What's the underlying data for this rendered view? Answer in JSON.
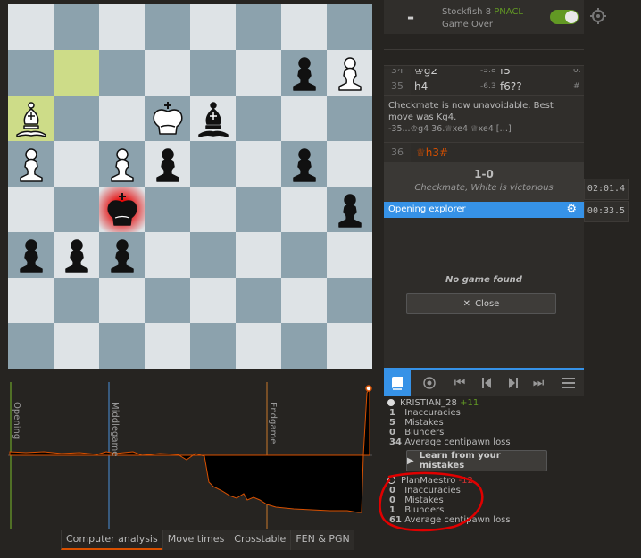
{
  "board": {
    "squares": [
      {
        "sq": "g7",
        "piece": "bp"
      },
      {
        "sq": "h7",
        "piece": "wp"
      },
      {
        "sq": "a6",
        "piece": "wb"
      },
      {
        "sq": "d6",
        "piece": "wk"
      },
      {
        "sq": "e6",
        "piece": "bb"
      },
      {
        "sq": "a5",
        "piece": "wp"
      },
      {
        "sq": "c5",
        "piece": "wp"
      },
      {
        "sq": "d5",
        "piece": "bp"
      },
      {
        "sq": "g5",
        "piece": "bp"
      },
      {
        "sq": "c4",
        "piece": "bk"
      },
      {
        "sq": "h4",
        "piece": "bp"
      },
      {
        "sq": "a3",
        "piece": "bp"
      },
      {
        "sq": "b3",
        "piece": "bp"
      },
      {
        "sq": "c3",
        "piece": "bp"
      }
    ],
    "highlights": [
      "b7",
      "a6"
    ],
    "check": "c4"
  },
  "chart": {
    "phases": [
      "Opening",
      "Middlegame",
      "Endgame"
    ]
  },
  "analysis_tabs": [
    "Computer analysis",
    "Move times",
    "Crosstable",
    "FEN & PGN"
  ],
  "engine": {
    "eval": "-",
    "name": "Stockfish 8",
    "variant": "PNACL",
    "status": "Game Over"
  },
  "moves": {
    "row34": {
      "num": "34",
      "white": "♔g2",
      "wev": "-5.8",
      "black": "f5",
      "bev": "0."
    },
    "row35": {
      "num": "35",
      "white": "h4",
      "wev": "-6.3",
      "black": "f6??",
      "bev": "#"
    },
    "comment": "Checkmate is now unavoidable. Best move was Kg4.",
    "variation": "-35...♔g4 36.♕xe4 ♕xe4 […]",
    "row36": {
      "num": "36",
      "white": "♕h3#"
    }
  },
  "result": {
    "score": "1-0",
    "message": "Checkmate, White is victorious"
  },
  "explorer": {
    "title": "Opening explorer",
    "no_game": "No game found",
    "close": "Close"
  },
  "clocks": {
    "top": "02:01.4",
    "bottom": "00:33.5"
  },
  "summary": {
    "white": {
      "name": "KRISTIAN_28",
      "diff": "+11",
      "stats": [
        {
          "n": "1",
          "label": "Inaccuracies"
        },
        {
          "n": "5",
          "label": "Mistakes"
        },
        {
          "n": "0",
          "label": "Blunders"
        },
        {
          "n": "34",
          "label": "Average centipawn loss"
        }
      ]
    },
    "learn_button": "Learn from your mistakes",
    "black": {
      "name": "PlanMaestro",
      "diff": "-12",
      "stats": [
        {
          "n": "0",
          "label": "Inaccuracies"
        },
        {
          "n": "0",
          "label": "Mistakes"
        },
        {
          "n": "1",
          "label": "Blunders"
        },
        {
          "n": "61",
          "label": "Average centipawn loss"
        }
      ]
    }
  },
  "colors": {
    "accent": "#3692e7",
    "mate": "#d85000",
    "annotation": "#e00000",
    "toggle": "#629924"
  }
}
